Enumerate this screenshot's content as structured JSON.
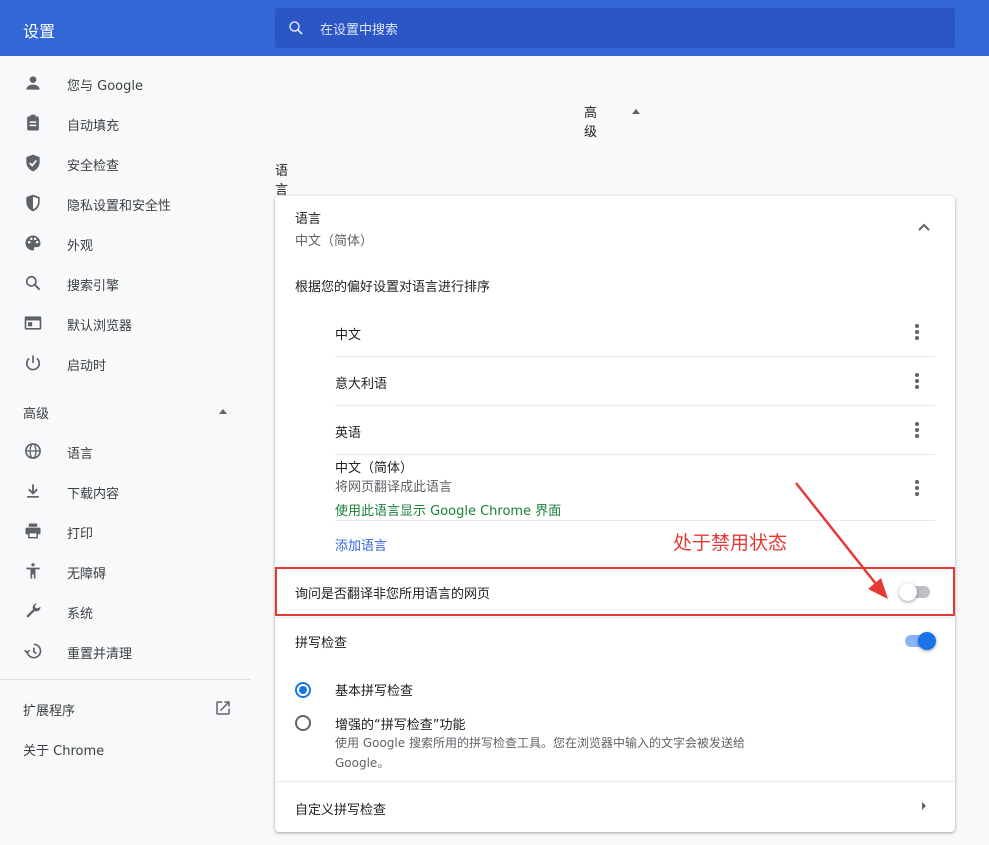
{
  "header": {
    "title": "设置",
    "search_placeholder": "在设置中搜索"
  },
  "sidebar": {
    "items": [
      {
        "label": "您与 Google",
        "icon": "person-icon"
      },
      {
        "label": "自动填充",
        "icon": "clipboard-icon"
      },
      {
        "label": "安全检查",
        "icon": "shield-check-icon"
      },
      {
        "label": "隐私设置和安全性",
        "icon": "shield-icon"
      },
      {
        "label": "外观",
        "icon": "palette-icon"
      },
      {
        "label": "搜索引擎",
        "icon": "search-icon"
      },
      {
        "label": "默认浏览器",
        "icon": "browser-icon"
      },
      {
        "label": "启动时",
        "icon": "power-icon"
      }
    ],
    "advanced_label": "高级",
    "advanced_items": [
      {
        "label": "语言",
        "icon": "globe-icon"
      },
      {
        "label": "下载内容",
        "icon": "download-icon"
      },
      {
        "label": "打印",
        "icon": "printer-icon"
      },
      {
        "label": "无障碍",
        "icon": "accessibility-icon"
      },
      {
        "label": "系统",
        "icon": "wrench-icon"
      },
      {
        "label": "重置并清理",
        "icon": "history-icon"
      }
    ],
    "extensions_label": "扩展程序",
    "about_label": "关于 Chrome"
  },
  "main": {
    "advanced_toggle_label": "高级",
    "section_title": "语言",
    "language_card": {
      "title": "语言",
      "current": "中文（简体）",
      "order_label": "根据您的偏好设置对语言进行排序",
      "languages": [
        {
          "name": "中文"
        },
        {
          "name": "意大利语"
        },
        {
          "name": "英语"
        },
        {
          "name": "中文（简体）",
          "note1": "将网页翻译成此语言",
          "note2": "使用此语言显示 Google Chrome 界面"
        }
      ],
      "add_language": "添加语言",
      "translate_prompt": "询问是否翻译非您所用语言的网页",
      "translate_enabled": false,
      "spellcheck_label": "拼写检查",
      "spellcheck_enabled": true,
      "basic_spellcheck": "基本拼写检查",
      "enhanced_spellcheck": "增强的“拼写检查”功能",
      "enhanced_desc_line1": "使用 Google 搜索所用的拼写检查工具。您在浏览器中输入的文字会被发送给",
      "enhanced_desc_line2": "Google。",
      "custom_spellcheck": "自定义拼写检查"
    }
  },
  "annotation": {
    "text": "处于禁用状态",
    "color": "#e53935"
  },
  "colors": {
    "header_bg": "#3367d6",
    "accent": "#1a73e8",
    "link": "#3367d6",
    "green": "#188038"
  }
}
